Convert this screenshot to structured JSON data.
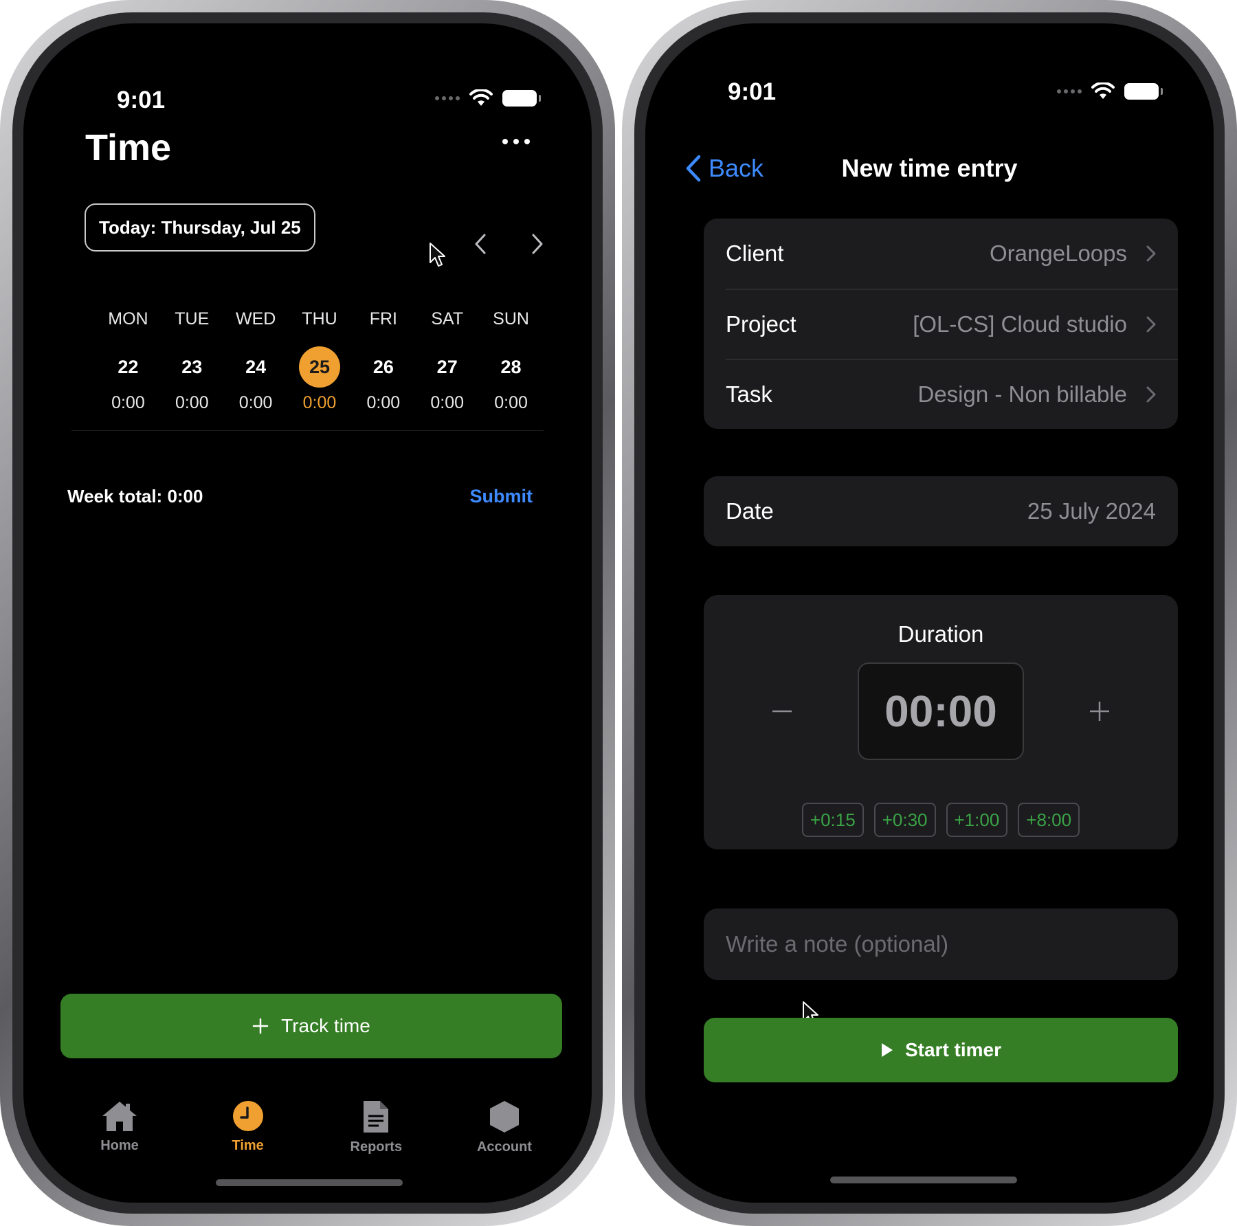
{
  "left": {
    "status": {
      "time": "9:01"
    },
    "header": {
      "title": "Time"
    },
    "today_label": "Today: Thursday, Jul 25",
    "week": [
      {
        "day": "MON",
        "date": "22",
        "hours": "0:00"
      },
      {
        "day": "TUE",
        "date": "23",
        "hours": "0:00"
      },
      {
        "day": "WED",
        "date": "24",
        "hours": "0:00"
      },
      {
        "day": "THU",
        "date": "25",
        "hours": "0:00"
      },
      {
        "day": "FRI",
        "date": "26",
        "hours": "0:00"
      },
      {
        "day": "SAT",
        "date": "27",
        "hours": "0:00"
      },
      {
        "day": "SUN",
        "date": "28",
        "hours": "0:00"
      }
    ],
    "week_total": "Week total: 0:00",
    "submit_label": "Submit",
    "track_button": "Track time",
    "tabs": [
      {
        "label": "Home",
        "icon": "house-icon"
      },
      {
        "label": "Time",
        "icon": "clock-icon"
      },
      {
        "label": "Reports",
        "icon": "document-icon"
      },
      {
        "label": "Account",
        "icon": "hexagon-icon"
      }
    ]
  },
  "right": {
    "status": {
      "time": "9:01"
    },
    "nav": {
      "back_label": "Back",
      "title": "New time entry"
    },
    "fields": [
      {
        "label": "Client",
        "value": "OrangeLoops"
      },
      {
        "label": "Project",
        "value": "[OL-CS] Cloud studio"
      },
      {
        "label": "Task",
        "value": "Design - Non billable"
      }
    ],
    "date": {
      "label": "Date",
      "value": "25 July 2024"
    },
    "duration": {
      "title": "Duration",
      "value": "00:00",
      "quick_adds": [
        "+0:15",
        "+0:30",
        "+1:00",
        "+8:00"
      ]
    },
    "note_placeholder": "Write a note (optional)",
    "start_button": "Start timer"
  },
  "colors": {
    "accent_orange": "#f0a030",
    "link_blue": "#3d8bff",
    "button_green": "#357e25",
    "chip_green": "#3aa345"
  }
}
